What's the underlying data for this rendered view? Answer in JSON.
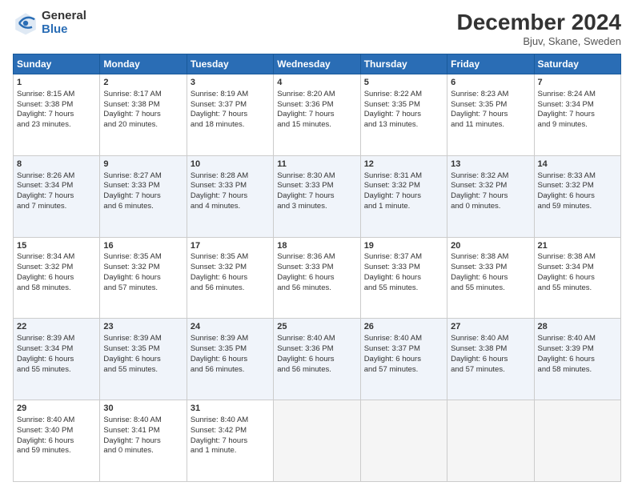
{
  "logo": {
    "general": "General",
    "blue": "Blue"
  },
  "title": "December 2024",
  "subtitle": "Bjuv, Skane, Sweden",
  "days_header": [
    "Sunday",
    "Monday",
    "Tuesday",
    "Wednesday",
    "Thursday",
    "Friday",
    "Saturday"
  ],
  "weeks": [
    [
      {
        "day": "1",
        "lines": [
          "Sunrise: 8:15 AM",
          "Sunset: 3:38 PM",
          "Daylight: 7 hours",
          "and 23 minutes."
        ]
      },
      {
        "day": "2",
        "lines": [
          "Sunrise: 8:17 AM",
          "Sunset: 3:38 PM",
          "Daylight: 7 hours",
          "and 20 minutes."
        ]
      },
      {
        "day": "3",
        "lines": [
          "Sunrise: 8:19 AM",
          "Sunset: 3:37 PM",
          "Daylight: 7 hours",
          "and 18 minutes."
        ]
      },
      {
        "day": "4",
        "lines": [
          "Sunrise: 8:20 AM",
          "Sunset: 3:36 PM",
          "Daylight: 7 hours",
          "and 15 minutes."
        ]
      },
      {
        "day": "5",
        "lines": [
          "Sunrise: 8:22 AM",
          "Sunset: 3:35 PM",
          "Daylight: 7 hours",
          "and 13 minutes."
        ]
      },
      {
        "day": "6",
        "lines": [
          "Sunrise: 8:23 AM",
          "Sunset: 3:35 PM",
          "Daylight: 7 hours",
          "and 11 minutes."
        ]
      },
      {
        "day": "7",
        "lines": [
          "Sunrise: 8:24 AM",
          "Sunset: 3:34 PM",
          "Daylight: 7 hours",
          "and 9 minutes."
        ]
      }
    ],
    [
      {
        "day": "8",
        "lines": [
          "Sunrise: 8:26 AM",
          "Sunset: 3:34 PM",
          "Daylight: 7 hours",
          "and 7 minutes."
        ]
      },
      {
        "day": "9",
        "lines": [
          "Sunrise: 8:27 AM",
          "Sunset: 3:33 PM",
          "Daylight: 7 hours",
          "and 6 minutes."
        ]
      },
      {
        "day": "10",
        "lines": [
          "Sunrise: 8:28 AM",
          "Sunset: 3:33 PM",
          "Daylight: 7 hours",
          "and 4 minutes."
        ]
      },
      {
        "day": "11",
        "lines": [
          "Sunrise: 8:30 AM",
          "Sunset: 3:33 PM",
          "Daylight: 7 hours",
          "and 3 minutes."
        ]
      },
      {
        "day": "12",
        "lines": [
          "Sunrise: 8:31 AM",
          "Sunset: 3:32 PM",
          "Daylight: 7 hours",
          "and 1 minute."
        ]
      },
      {
        "day": "13",
        "lines": [
          "Sunrise: 8:32 AM",
          "Sunset: 3:32 PM",
          "Daylight: 7 hours",
          "and 0 minutes."
        ]
      },
      {
        "day": "14",
        "lines": [
          "Sunrise: 8:33 AM",
          "Sunset: 3:32 PM",
          "Daylight: 6 hours",
          "and 59 minutes."
        ]
      }
    ],
    [
      {
        "day": "15",
        "lines": [
          "Sunrise: 8:34 AM",
          "Sunset: 3:32 PM",
          "Daylight: 6 hours",
          "and 58 minutes."
        ]
      },
      {
        "day": "16",
        "lines": [
          "Sunrise: 8:35 AM",
          "Sunset: 3:32 PM",
          "Daylight: 6 hours",
          "and 57 minutes."
        ]
      },
      {
        "day": "17",
        "lines": [
          "Sunrise: 8:35 AM",
          "Sunset: 3:32 PM",
          "Daylight: 6 hours",
          "and 56 minutes."
        ]
      },
      {
        "day": "18",
        "lines": [
          "Sunrise: 8:36 AM",
          "Sunset: 3:33 PM",
          "Daylight: 6 hours",
          "and 56 minutes."
        ]
      },
      {
        "day": "19",
        "lines": [
          "Sunrise: 8:37 AM",
          "Sunset: 3:33 PM",
          "Daylight: 6 hours",
          "and 55 minutes."
        ]
      },
      {
        "day": "20",
        "lines": [
          "Sunrise: 8:38 AM",
          "Sunset: 3:33 PM",
          "Daylight: 6 hours",
          "and 55 minutes."
        ]
      },
      {
        "day": "21",
        "lines": [
          "Sunrise: 8:38 AM",
          "Sunset: 3:34 PM",
          "Daylight: 6 hours",
          "and 55 minutes."
        ]
      }
    ],
    [
      {
        "day": "22",
        "lines": [
          "Sunrise: 8:39 AM",
          "Sunset: 3:34 PM",
          "Daylight: 6 hours",
          "and 55 minutes."
        ]
      },
      {
        "day": "23",
        "lines": [
          "Sunrise: 8:39 AM",
          "Sunset: 3:35 PM",
          "Daylight: 6 hours",
          "and 55 minutes."
        ]
      },
      {
        "day": "24",
        "lines": [
          "Sunrise: 8:39 AM",
          "Sunset: 3:35 PM",
          "Daylight: 6 hours",
          "and 56 minutes."
        ]
      },
      {
        "day": "25",
        "lines": [
          "Sunrise: 8:40 AM",
          "Sunset: 3:36 PM",
          "Daylight: 6 hours",
          "and 56 minutes."
        ]
      },
      {
        "day": "26",
        "lines": [
          "Sunrise: 8:40 AM",
          "Sunset: 3:37 PM",
          "Daylight: 6 hours",
          "and 57 minutes."
        ]
      },
      {
        "day": "27",
        "lines": [
          "Sunrise: 8:40 AM",
          "Sunset: 3:38 PM",
          "Daylight: 6 hours",
          "and 57 minutes."
        ]
      },
      {
        "day": "28",
        "lines": [
          "Sunrise: 8:40 AM",
          "Sunset: 3:39 PM",
          "Daylight: 6 hours",
          "and 58 minutes."
        ]
      }
    ],
    [
      {
        "day": "29",
        "lines": [
          "Sunrise: 8:40 AM",
          "Sunset: 3:40 PM",
          "Daylight: 6 hours",
          "and 59 minutes."
        ]
      },
      {
        "day": "30",
        "lines": [
          "Sunrise: 8:40 AM",
          "Sunset: 3:41 PM",
          "Daylight: 7 hours",
          "and 0 minutes."
        ]
      },
      {
        "day": "31",
        "lines": [
          "Sunrise: 8:40 AM",
          "Sunset: 3:42 PM",
          "Daylight: 7 hours",
          "and 1 minute."
        ]
      },
      null,
      null,
      null,
      null
    ]
  ]
}
